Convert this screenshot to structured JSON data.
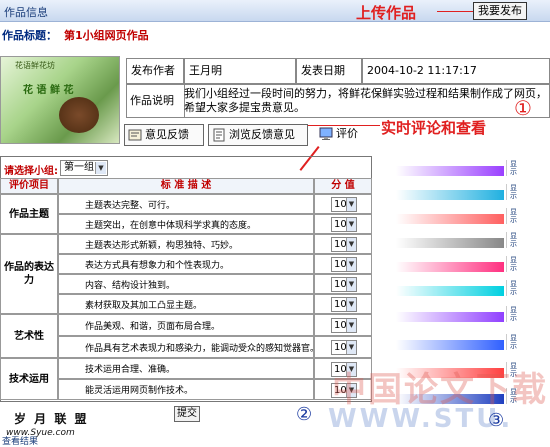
{
  "header": {
    "title": "作品信息",
    "upload_annotation": "上传作品",
    "publish_button": "我要发布"
  },
  "work": {
    "title_label": "作品标题：",
    "title_value": "第1小组网页作品",
    "thumbnail_caption": "花语鲜花坊",
    "thumbnail_text": "花 语 鲜 花"
  },
  "info": {
    "author_label": "发布作者",
    "author_value": "王月明",
    "date_label": "发表日期",
    "date_value": "2004-10-2 11:17:17",
    "desc_label": "作品说明",
    "desc_value": "我们小组经过一段时间的努力，将鲜花保鲜实验过程和结果制作成了网页，希望大家多提宝贵意见。"
  },
  "tabs": {
    "feedback": "意见反馈",
    "browse_feedback": "浏览反馈意见",
    "rate": "评价"
  },
  "annotations": {
    "realtime": "实时评论和查看",
    "circle_1": "①",
    "circle_2": "②",
    "circle_3": "③"
  },
  "evaluation": {
    "group_label": "请选择小组:",
    "group_selected": "第一组",
    "headers": {
      "category": "评价项目",
      "criteria": "标 准 描 述",
      "score": "分 值"
    },
    "rows": [
      {
        "criterion": "主题表达完整、可行。",
        "score": "10"
      },
      {
        "criterion": "主题突出，在创意中体现科学求真的态度。",
        "score": "10"
      },
      {
        "criterion": "主题表达形式新颖，构思独特、巧妙。",
        "score": "10"
      },
      {
        "criterion": "表达方式具有想象力和个性表现力。",
        "score": "10"
      },
      {
        "criterion": "内容、结构设计独到。",
        "score": "10"
      },
      {
        "criterion": "素材获取及其加工凸显主题。",
        "score": "10"
      },
      {
        "criterion": "作品美观、和谐，页面布局合理。",
        "score": "10"
      },
      {
        "criterion": "作品具有艺术表现力和感染力，能调动受众的感知觉器官。",
        "score": "10"
      },
      {
        "criterion": "技术运用合理、准确。",
        "score": "10"
      },
      {
        "criterion": "能灵活运用网页制作技术。",
        "score": "10"
      }
    ],
    "categories": {
      "theme": "作品主题",
      "expression": "作品的表达力",
      "art": "艺术性",
      "tech": "技术运用"
    },
    "submit": "提交",
    "view_result": "查看结果"
  },
  "side": {
    "bar_colors": [
      "#9a40ff",
      "#20b0e0",
      "#ff6060",
      "#888888",
      "#ff3080",
      "#00d0e0",
      "#9040ff",
      "#3060ff",
      "#ff4040",
      "#2040c0"
    ],
    "label_texts": [
      "显示",
      "显示",
      "显示",
      "显示",
      "显示",
      "显示",
      "显示",
      "显示",
      "显示",
      "显示"
    ]
  },
  "watermark": {
    "cn": "中国论文下载",
    "stu": "WWW.STU.",
    "logo": "岁 月 联 盟",
    "site": "www.Syue.com"
  },
  "colors": {
    "accent_red": "#e02020",
    "title_blue": "#1a3d7a",
    "header_bg": "#c8d8ef"
  }
}
